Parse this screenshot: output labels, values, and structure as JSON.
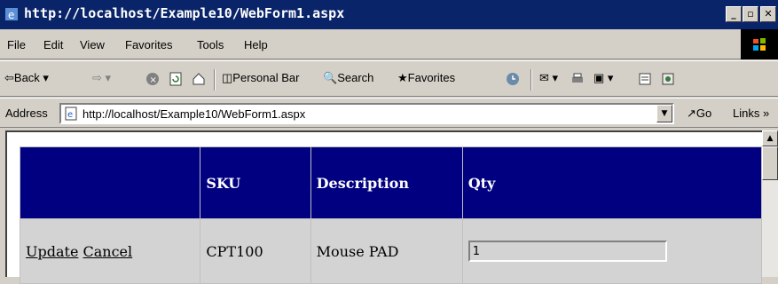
{
  "window": {
    "title": "http://localhost/Example10/WebForm1.aspx",
    "minimize_label": "_",
    "maximize_label": "▫",
    "close_label": "✕"
  },
  "menu": [
    "File",
    "Edit",
    "View",
    "Favorites",
    "Tools",
    "Help"
  ],
  "toolbar": {
    "back_label": "Back",
    "personal_bar_label": "Personal Bar",
    "search_label": "Search",
    "favorites_label": "Favorites"
  },
  "address": {
    "label": "Address",
    "url": "http://localhost/Example10/WebForm1.aspx",
    "go_label": "Go",
    "links_label": "Links"
  },
  "grid": {
    "headers": [
      "",
      "SKU",
      "Description",
      "Qty"
    ],
    "row": {
      "update_label": "Update",
      "cancel_label": "Cancel",
      "sku": "CPT100",
      "description": "Mouse PAD",
      "qty_value": "1"
    }
  },
  "colors": {
    "titlebar": "#0a246a",
    "header_bg": "#000080",
    "row_bg": "#d3d3d3"
  }
}
